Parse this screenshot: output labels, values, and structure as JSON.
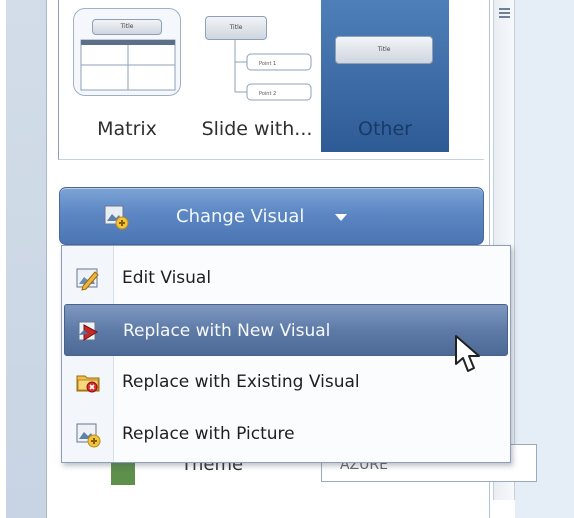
{
  "gallery": {
    "tiles": [
      {
        "label": "Matrix",
        "mini_title": "Title",
        "selected": false
      },
      {
        "label": "Slide with...",
        "mini_title": "Title",
        "mini_items": [
          "Point 1",
          "Point 2"
        ],
        "selected": false
      },
      {
        "label": "Other",
        "mini_title": "Title",
        "selected": true
      }
    ]
  },
  "change_visual": {
    "label": "Change Visual",
    "icon": "change-visual-icon"
  },
  "dropdown": {
    "items": [
      {
        "label": "Edit Visual",
        "icon": "edit-visual-icon",
        "selected": false
      },
      {
        "label": "Replace with New Visual",
        "icon": "new-visual-icon",
        "selected": true
      },
      {
        "label": "Replace with Existing Visual",
        "icon": "existing-visual-icon",
        "selected": false
      },
      {
        "label": "Replace with Picture",
        "icon": "picture-icon",
        "selected": false
      }
    ]
  },
  "theme": {
    "label": "Theme",
    "value": "AZURE"
  },
  "colors": {
    "accent": "#4b76b4",
    "menu_highlight": "#5e7ba8",
    "panel_border": "#a9b8cc"
  }
}
